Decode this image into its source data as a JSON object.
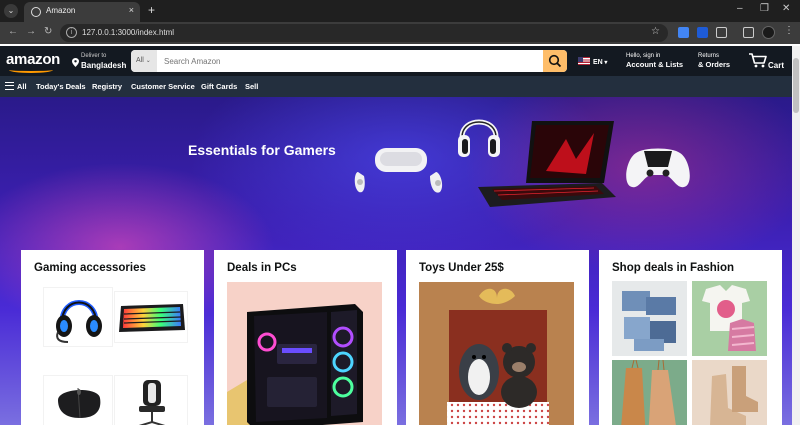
{
  "browser": {
    "tab_title": "Amazon",
    "url": "127.0.0.1:3000/index.html",
    "new_tab": "+",
    "tab_close": "×"
  },
  "header": {
    "logo": "amazon",
    "deliver_small": "Deliver to",
    "deliver_big": "Bangladesh",
    "search_category": "All",
    "search_placeholder": "Search Amazon",
    "lang": "EN",
    "account_small": "Hello, sign in",
    "account_big": "Account & Lists",
    "returns_small": "Returns",
    "returns_big": "& Orders",
    "cart": "Cart"
  },
  "subnav": {
    "all": "All",
    "items": [
      "Today's Deals",
      "Registry",
      "Customer Service",
      "Gift Cards",
      "Sell"
    ]
  },
  "hero": {
    "title": "Essentials for Gamers"
  },
  "cards": [
    {
      "title": "Gaming accessories",
      "images": [
        "headset",
        "keyboard",
        "mouse",
        "gaming-chair"
      ]
    },
    {
      "title": "Deals in PCs",
      "images": [
        "gaming-pc"
      ]
    },
    {
      "title": "Toys Under 25$",
      "images": [
        "plush-toys"
      ]
    },
    {
      "title": "Shop deals in Fashion",
      "images": [
        "jeans",
        "tops",
        "dresses",
        "boots"
      ]
    }
  ],
  "colors": {
    "header_bg": "#131921",
    "subnav_bg": "#232f3e",
    "search_button": "#febd69",
    "accent": "#ff9900"
  }
}
